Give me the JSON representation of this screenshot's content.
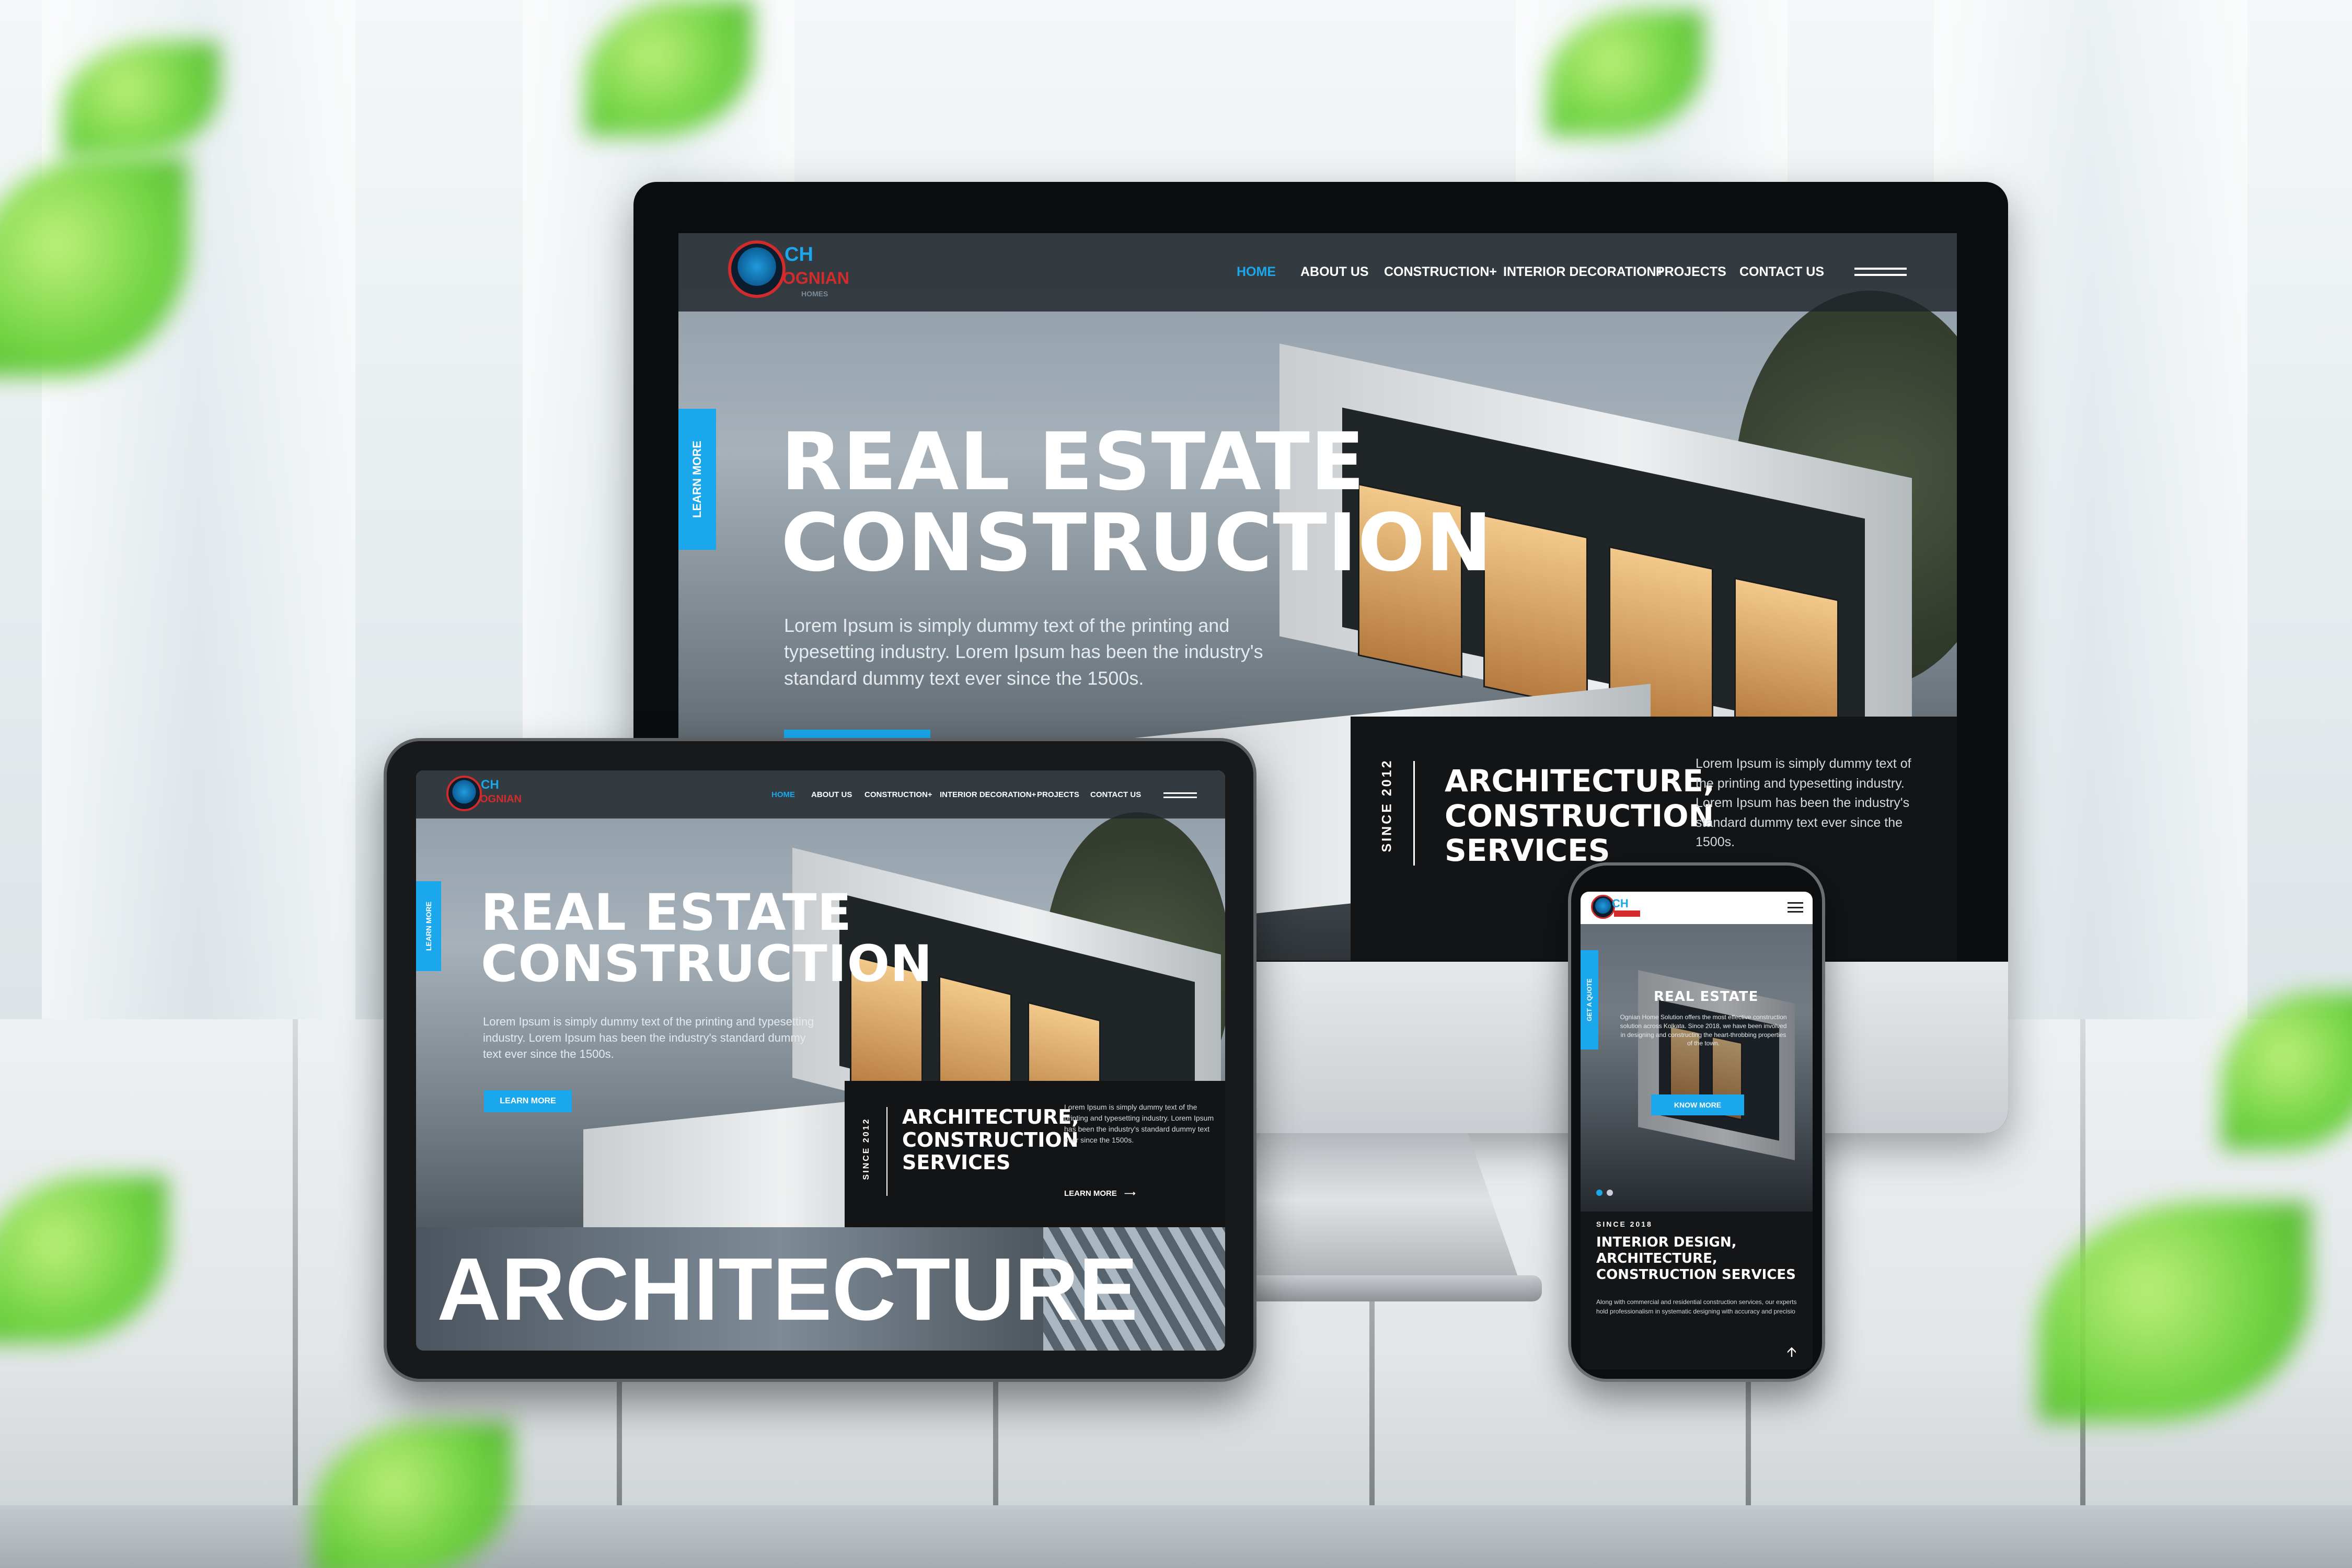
{
  "desktop": {
    "nav": {
      "items": [
        "HOME",
        "ABOUT US",
        "CONSTRUCTION+",
        "INTERIOR DECORATION+",
        "PROJECTS",
        "CONTACT US"
      ],
      "active_index": 0
    },
    "logo": {
      "monogram": "CH",
      "brand": "OGNIAN",
      "sub": "HOMES"
    },
    "side_tab": "LEARN MORE",
    "hero": {
      "title_line1": "REAL ESTATE",
      "title_line2": "CONSTRUCTION",
      "text": "Lorem Ipsum is simply dummy text of the printing and typesetting industry. Lorem Ipsum has been the industry's standard dummy text ever since the 1500s."
    },
    "box": {
      "since": "SINCE 2012",
      "title": [
        "ARCHITECTURE,",
        "CONSTRUCTION",
        "SERVICES"
      ],
      "text": "Lorem Ipsum is simply dummy text of the printing and typesetting industry. Lorem Ipsum has been the industry's standard dummy text ever since the 1500s."
    }
  },
  "tablet": {
    "nav": {
      "items": [
        "HOME",
        "ABOUT US",
        "CONSTRUCTION+",
        "INTERIOR DECORATION+",
        "PROJECTS",
        "CONTACT US"
      ],
      "active_index": 0
    },
    "logo": {
      "monogram": "CH",
      "brand": "OGNIAN"
    },
    "side_tab": "LEARN MORE",
    "hero": {
      "title_line1": "REAL ESTATE",
      "title_line2": "CONSTRUCTION",
      "text": "Lorem Ipsum is simply dummy text of the printing and typesetting industry. Lorem Ipsum has been the industry's standard dummy text ever since the 1500s.",
      "button": "LEARN MORE"
    },
    "box": {
      "since": "SINCE 2012",
      "title": [
        "ARCHITECTURE,",
        "CONSTRUCTION",
        "SERVICES"
      ],
      "text": "Lorem Ipsum is simply dummy text of the printing and typesetting industry. Lorem Ipsum has been the industry's standard dummy text ever since the 1500s.",
      "link": "LEARN MORE"
    },
    "banner": "ARCHITECTURE"
  },
  "phone": {
    "logo": {
      "monogram": "CH"
    },
    "side_tab": "GET A QUOTE",
    "hero": {
      "title": "REAL ESTATE",
      "text": "Ognian Home Solution offers the most effective construction solution across Kolkata. Since 2018, we have been involved in designing and constructing the heart-throbbing properties of the town.",
      "button": "KNOW MORE"
    },
    "section": {
      "since": "SINCE 2018",
      "title": [
        "INTERIOR DESIGN,",
        "ARCHITECTURE,",
        "CONSTRUCTION SERVICES"
      ],
      "text": "Along with commercial and residential construction services, our experts hold professionalism in systematic designing with accuracy and precisio"
    }
  },
  "colors": {
    "accent": "#1aa7ec",
    "logo_red": "#d22b2b",
    "dark_panel": "#121416"
  }
}
